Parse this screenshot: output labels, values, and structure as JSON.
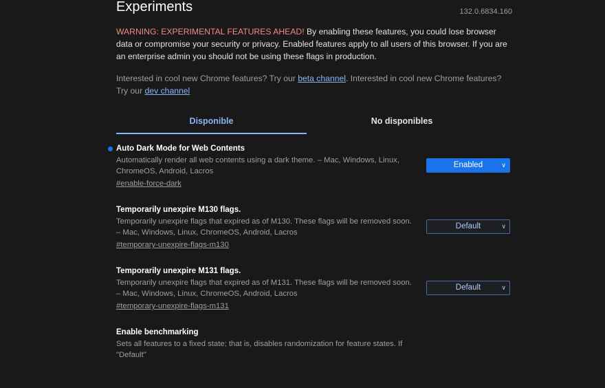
{
  "header": {
    "title": "Experiments",
    "version": "132.0.6834.160"
  },
  "warning": {
    "prefix": "WARNING: EXPERIMENTAL FEATURES AHEAD!",
    "body": " By enabling these features, you could lose browser data or compromise your security or privacy. Enabled features apply to all users of this browser. If you are an enterprise admin you should not be using these flags in production."
  },
  "blurb": {
    "part1": "Interested in cool new Chrome features? Try our ",
    "beta_link": "beta channel",
    "part2": ". Interested in cool new Chrome features? Try our ",
    "dev_link": "dev channel"
  },
  "tabs": [
    {
      "label": "Disponible"
    },
    {
      "label": "No disponibles"
    }
  ],
  "flags": [
    {
      "name": "Auto Dark Mode for Web Contents",
      "desc": "Automatically render all web contents using a dark theme. – Mac, Windows, Linux, ChromeOS, Android, Lacros",
      "id": "#enable-force-dark",
      "value": "Enabled"
    },
    {
      "name": "Temporarily unexpire M130 flags.",
      "desc": "Temporarily unexpire flags that expired as of M130. These flags will be removed soon. – Mac, Windows, Linux, ChromeOS, Android, Lacros",
      "id": "#temporary-unexpire-flags-m130",
      "value": "Default"
    },
    {
      "name": "Temporarily unexpire M131 flags.",
      "desc": "Temporarily unexpire flags that expired as of M131. These flags will be removed soon. – Mac, Windows, Linux, ChromeOS, Android, Lacros",
      "id": "#temporary-unexpire-flags-m131",
      "value": "Default"
    },
    {
      "name": "Enable benchmarking",
      "desc": "Sets all features to a fixed state; that is, disables randomization for feature states. If \"Default\"",
      "id": "",
      "value": ""
    }
  ],
  "colors": {
    "background": "#191919",
    "accent": "#8ab4f8",
    "warning": "#f28b82",
    "enabled": "#1a73e8"
  }
}
